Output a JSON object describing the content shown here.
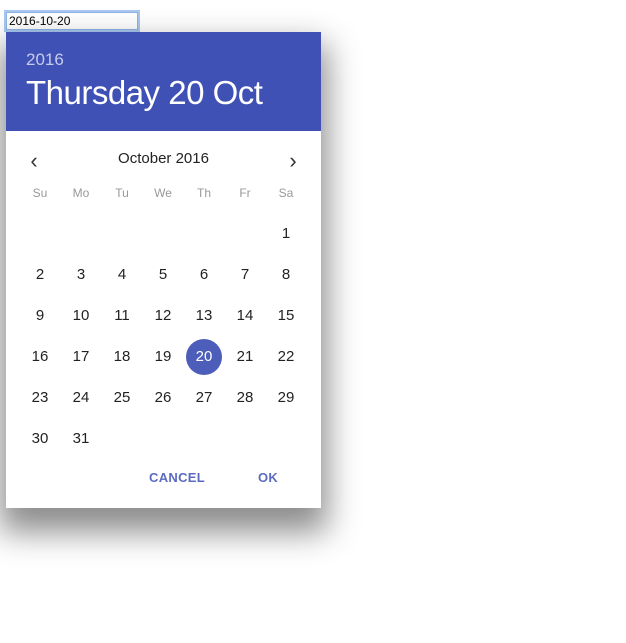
{
  "input": {
    "value": "2016-10-20"
  },
  "header": {
    "year": "2016",
    "date": "Thursday 20 Oct"
  },
  "calendar": {
    "month_label": "October 2016",
    "prev_icon": "chevron-left-icon",
    "next_icon": "chevron-right-icon",
    "weekdays": [
      "Su",
      "Mo",
      "Tu",
      "We",
      "Th",
      "Fr",
      "Sa"
    ],
    "weeks": [
      [
        "",
        "",
        "",
        "",
        "",
        "",
        "1"
      ],
      [
        "2",
        "3",
        "4",
        "5",
        "6",
        "7",
        "8"
      ],
      [
        "9",
        "10",
        "11",
        "12",
        "13",
        "14",
        "15"
      ],
      [
        "16",
        "17",
        "18",
        "19",
        "20",
        "21",
        "22"
      ],
      [
        "23",
        "24",
        "25",
        "26",
        "27",
        "28",
        "29"
      ],
      [
        "30",
        "31",
        "",
        "",
        "",
        "",
        ""
      ]
    ],
    "selected": "20"
  },
  "actions": {
    "cancel": "CANCEL",
    "ok": "OK"
  },
  "colors": {
    "accent": "#3f51b5",
    "button_text": "#5c6bc0"
  }
}
